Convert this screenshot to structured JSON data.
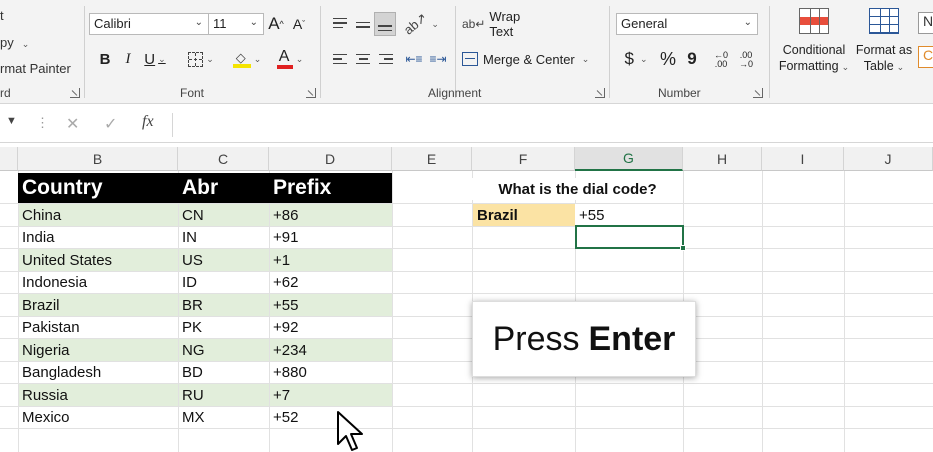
{
  "ribbon": {
    "clipboard": {
      "cut_partial": "t",
      "copy_partial": "py",
      "format_painter_partial": "rmat Painter",
      "group_label_partial": "rd"
    },
    "font": {
      "name": "Calibri",
      "size": "11",
      "bold": "B",
      "italic": "I",
      "underline": "U",
      "grow_label": "A",
      "shrink_label": "A",
      "color_label": "A",
      "group_label": "Font"
    },
    "alignment": {
      "wrap_text": "Wrap Text",
      "merge_center": "Merge & Center",
      "group_label": "Alignment"
    },
    "number": {
      "format": "General",
      "currency": "$",
      "percent": "%",
      "comma": "9",
      "inc_decimal": "←0 .00",
      "dec_decimal": ".00 →0",
      "group_label": "Number"
    },
    "styles": {
      "conditional_formatting": [
        "Conditional",
        "Formatting"
      ],
      "format_as_table": [
        "Format as",
        "Table"
      ],
      "cell_styles_partial": "N"
    }
  },
  "formula_bar": {
    "fx": "fx",
    "cancel": "✕",
    "enter": "✓"
  },
  "columns": [
    "B",
    "C",
    "D",
    "E",
    "F",
    "G",
    "H",
    "I",
    "J"
  ],
  "active_column": "G",
  "table": {
    "headers": [
      "Country",
      "Abr",
      "Prefix"
    ],
    "rows": [
      [
        "China",
        "CN",
        "+86"
      ],
      [
        "India",
        "IN",
        "+91"
      ],
      [
        "United States",
        "US",
        "+1"
      ],
      [
        "Indonesia",
        "ID",
        "+62"
      ],
      [
        "Brazil",
        "BR",
        "+55"
      ],
      [
        "Pakistan",
        "PK",
        "+92"
      ],
      [
        "Nigeria",
        "NG",
        "+234"
      ],
      [
        "Bangladesh",
        "BD",
        "+880"
      ],
      [
        "Russia",
        "RU",
        "+7"
      ],
      [
        "Mexico",
        "MX",
        "+52"
      ]
    ]
  },
  "lookup": {
    "question": "What is the dial code?",
    "input_value": "Brazil",
    "result_value": "+55"
  },
  "callout": {
    "prefix": "Press",
    "key": "Enter"
  },
  "colors": {
    "header_bg": "#000000",
    "band_green": "#e2eedb",
    "lookup_input_bg": "#fbe3a4",
    "excel_green": "#217346"
  }
}
